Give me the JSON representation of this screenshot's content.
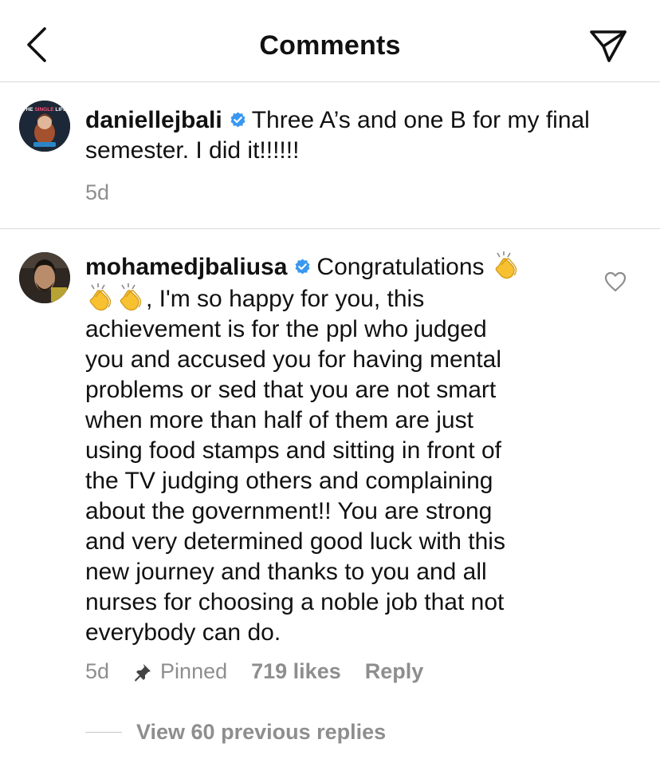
{
  "header": {
    "title": "Comments"
  },
  "caption": {
    "avatar_text_top": "THE",
    "avatar_text_brand": "SINGLE",
    "avatar_text_end": "LIFE",
    "username": "daniellejbali",
    "text_line1": "Three A’s and one B for my final",
    "text_line2": "semester. I did it!!!!!!",
    "age": "5d"
  },
  "comment": {
    "username": "mohamedjbaliusa",
    "text_start": "Congratulations",
    "text_after_claps": ", I'm so happy for you, this",
    "lines": [
      "achievement is for the ppl who judged",
      "you and accused you for having mental",
      "problems or sed that you are not smart",
      "when more than half of them are just",
      "using food stamps and sitting in front of",
      "the TV judging others and complaining",
      "about the government!! You are strong",
      "and very determined good luck with this",
      "new journey and thanks to you and all",
      "nurses for choosing a noble job that not",
      "everybody can do."
    ],
    "age": "5d",
    "pinned_label": "Pinned",
    "likes": "719 likes",
    "reply_label": "Reply"
  },
  "replies": {
    "view_label": "View 60 previous replies"
  },
  "colors": {
    "verified_blue": "#3897f0",
    "clap_yellow": "#f7c131",
    "meta_gray": "#8e8e8e",
    "divider": "#dbdbdb"
  },
  "icons": {
    "back": "chevron-left-icon",
    "share": "paper-plane-icon",
    "verified": "verified-badge-icon",
    "pin": "pin-icon",
    "like": "heart-outline-icon",
    "clap": "clapping-hands-emoji"
  }
}
